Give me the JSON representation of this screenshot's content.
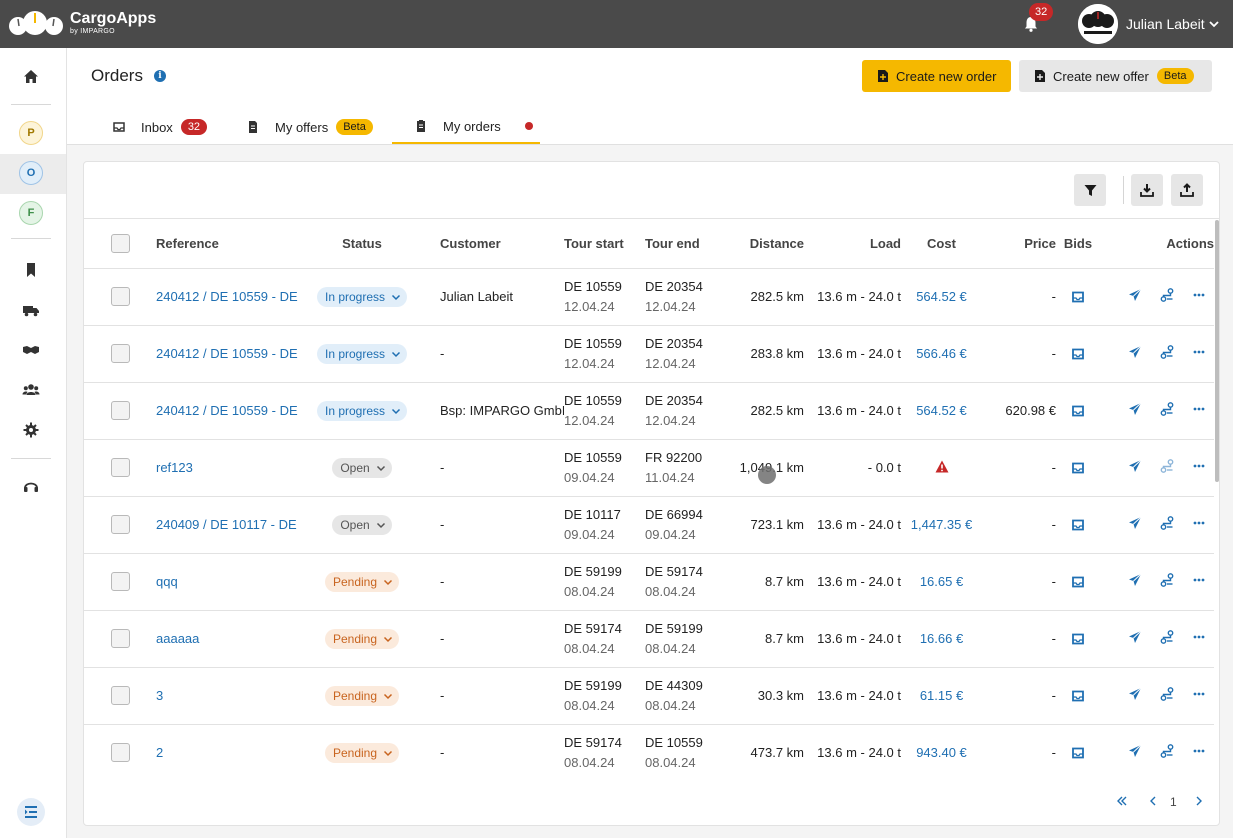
{
  "app": {
    "name": "CargoApps",
    "by": "by IMPARGO",
    "notifications": "32"
  },
  "user": {
    "name": "Julian Labeit"
  },
  "sidebar": {
    "circles": [
      "P",
      "O",
      "F"
    ]
  },
  "header": {
    "title": "Orders",
    "create_order": "Create new order",
    "create_offer": "Create new offer",
    "beta": "Beta"
  },
  "tabs": [
    {
      "label": "Inbox",
      "badge": "32"
    },
    {
      "label": "My offers",
      "badge": "Beta"
    },
    {
      "label": "My orders"
    }
  ],
  "table": {
    "columns": [
      "Reference",
      "Status",
      "Customer",
      "Tour start",
      "Tour end",
      "Distance",
      "Load",
      "Cost",
      "Price",
      "Bids",
      "Actions"
    ],
    "rows": [
      {
        "ref": "240412 / DE 10559 - DE",
        "status": "In progress",
        "customer": "Julian Labeit",
        "start": "DE 10559",
        "start_date": "12.04.24",
        "end": "DE 20354",
        "end_date": "12.04.24",
        "distance": "282.5 km",
        "load": "13.6 m - 24.0 t",
        "cost": "564.52 €",
        "price": "-"
      },
      {
        "ref": "240412 / DE 10559 - DE",
        "status": "In progress",
        "customer": "-",
        "start": "DE 10559",
        "start_date": "12.04.24",
        "end": "DE 20354",
        "end_date": "12.04.24",
        "distance": "283.8 km",
        "load": "13.6 m - 24.0 t",
        "cost": "566.46 €",
        "price": "-"
      },
      {
        "ref": "240412 / DE 10559 - DE",
        "status": "In progress",
        "customer": "Bsp: IMPARGO GmbH",
        "start": "DE 10559",
        "start_date": "12.04.24",
        "end": "DE 20354",
        "end_date": "12.04.24",
        "distance": "282.5 km",
        "load": "13.6 m - 24.0 t",
        "cost": "564.52 €",
        "price": "620.98 €"
      },
      {
        "ref": "ref123",
        "status": "Open",
        "customer": "-",
        "start": "DE 10559",
        "start_date": "09.04.24",
        "end": "FR 92200",
        "end_date": "11.04.24",
        "distance": "1,049.1 km",
        "load": "- 0.0 t",
        "cost": "",
        "price": "-"
      },
      {
        "ref": "240409 / DE 10117 - DE",
        "status": "Open",
        "customer": "-",
        "start": "DE 10117",
        "start_date": "09.04.24",
        "end": "DE 66994",
        "end_date": "09.04.24",
        "distance": "723.1 km",
        "load": "13.6 m - 24.0 t",
        "cost": "1,447.35 €",
        "price": "-"
      },
      {
        "ref": "qqq",
        "status": "Pending",
        "customer": "-",
        "start": "DE 59199",
        "start_date": "08.04.24",
        "end": "DE 59174",
        "end_date": "08.04.24",
        "distance": "8.7 km",
        "load": "13.6 m - 24.0 t",
        "cost": "16.65 €",
        "price": "-"
      },
      {
        "ref": "aaaaaa",
        "status": "Pending",
        "customer": "-",
        "start": "DE 59174",
        "start_date": "08.04.24",
        "end": "DE 59199",
        "end_date": "08.04.24",
        "distance": "8.7 km",
        "load": "13.6 m - 24.0 t",
        "cost": "16.66 €",
        "price": "-"
      },
      {
        "ref": "3",
        "status": "Pending",
        "customer": "-",
        "start": "DE 59199",
        "start_date": "08.04.24",
        "end": "DE 44309",
        "end_date": "08.04.24",
        "distance": "30.3 km",
        "load": "13.6 m - 24.0 t",
        "cost": "61.15 €",
        "price": "-"
      },
      {
        "ref": "2",
        "status": "Pending",
        "customer": "-",
        "start": "DE 59174",
        "start_date": "08.04.24",
        "end": "DE 10559",
        "end_date": "08.04.24",
        "distance": "473.7 km",
        "load": "13.6 m - 24.0 t",
        "cost": "943.40 €",
        "price": "-"
      }
    ]
  },
  "pagination": {
    "page": "1"
  }
}
